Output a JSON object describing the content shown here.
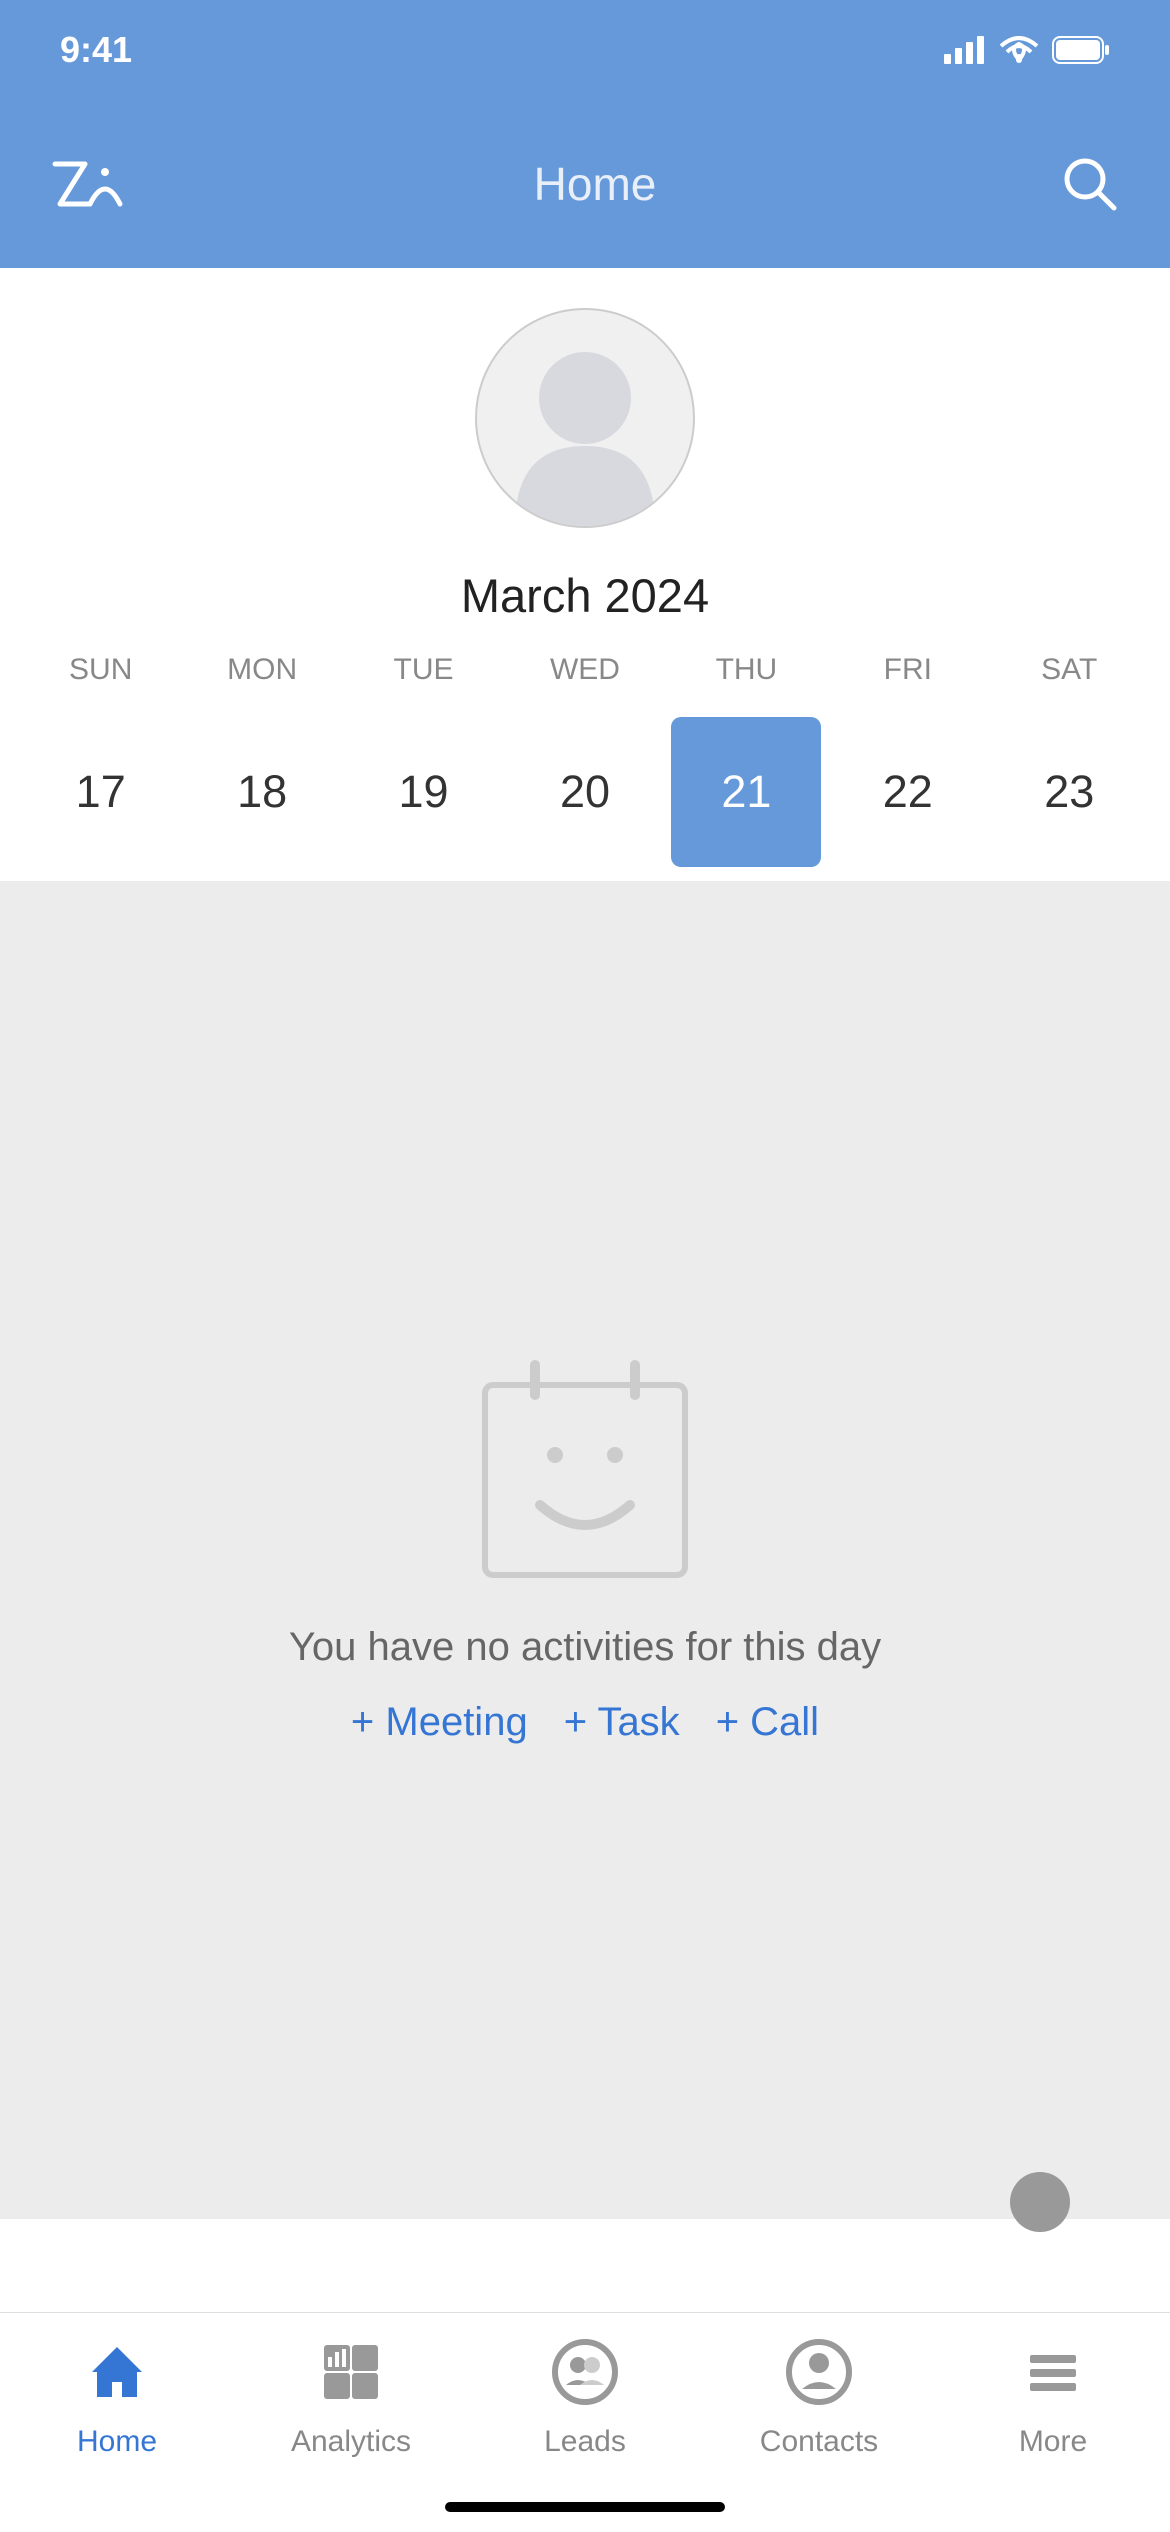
{
  "status": {
    "time": "9:41"
  },
  "header": {
    "title": "Home"
  },
  "calendar": {
    "month": "March 2024",
    "days": [
      {
        "abbr": "SUN",
        "num": "17"
      },
      {
        "abbr": "MON",
        "num": "18"
      },
      {
        "abbr": "TUE",
        "num": "19"
      },
      {
        "abbr": "WED",
        "num": "20"
      },
      {
        "abbr": "THU",
        "num": "21"
      },
      {
        "abbr": "FRI",
        "num": "22"
      },
      {
        "abbr": "SAT",
        "num": "23"
      }
    ],
    "selected_index": 4
  },
  "activities": {
    "empty_text": "You have no activities for this day",
    "actions": {
      "meeting": "+ Meeting",
      "task": "+ Task",
      "call": "+ Call"
    }
  },
  "tabs": {
    "home": "Home",
    "analytics": "Analytics",
    "leads": "Leads",
    "contacts": "Contacts",
    "more": "More"
  }
}
